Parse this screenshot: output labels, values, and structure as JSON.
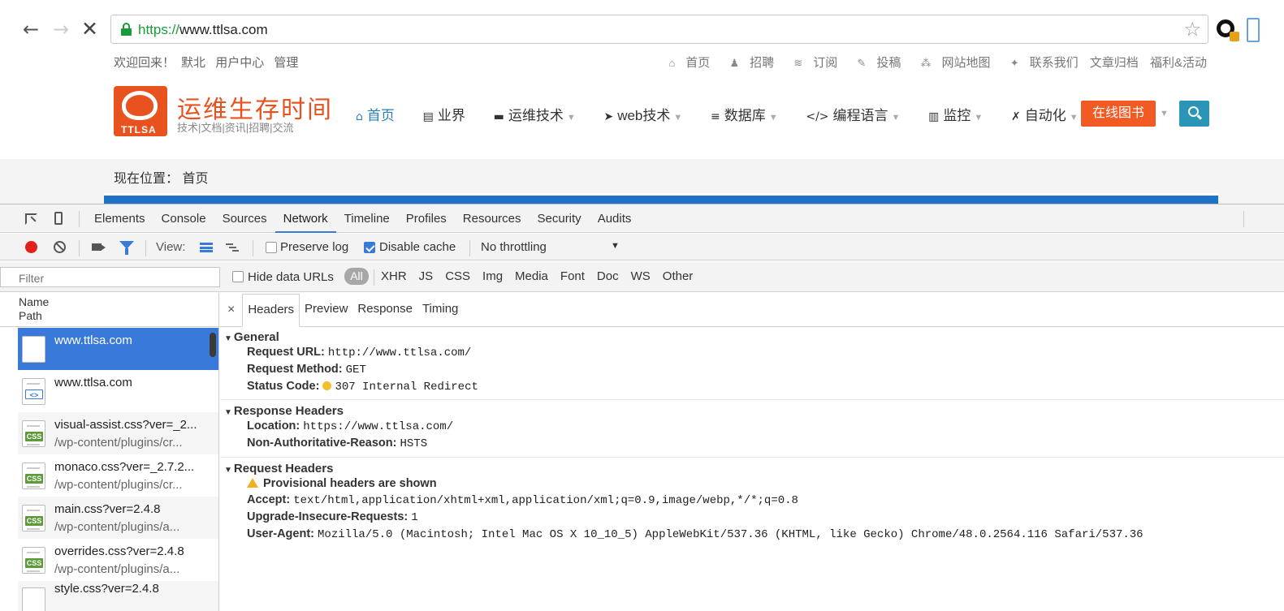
{
  "browser": {
    "url_scheme": "https://",
    "url_rest": "www.ttlsa.com",
    "star_icon": "bookmark-star-icon"
  },
  "site": {
    "welcome": "欢迎回来！",
    "user": "默北",
    "user_center": "用户中心",
    "manage": "管理",
    "top_links": [
      "首页",
      "招聘",
      "订阅",
      "投稿",
      "网站地图",
      "联系我们",
      "文章归档",
      "福利&活动"
    ],
    "logo_tag": "TTLSA",
    "logo_title": "运维生存时间",
    "logo_subtitle": "技术|文档|资讯|招聘|交流",
    "nav": [
      "首页",
      "业界",
      "运维技术",
      "web技术",
      "数据库",
      "编程语言",
      "监控",
      "自动化"
    ],
    "online_book": "在线图书",
    "breadcrumb_label": "现在位置：",
    "breadcrumb_home": "首页"
  },
  "devtools": {
    "tabs": [
      "Elements",
      "Console",
      "Sources",
      "Network",
      "Timeline",
      "Profiles",
      "Resources",
      "Security",
      "Audits"
    ],
    "active_tab": "Network",
    "view_label": "View:",
    "preserve_log": "Preserve log",
    "preserve_log_checked": false,
    "disable_cache": "Disable cache",
    "disable_cache_checked": true,
    "throttling": "No throttling",
    "filter_placeholder": "Filter",
    "hide_data_urls": "Hide data URLs",
    "type_all": "All",
    "type_filters": [
      "XHR",
      "JS",
      "CSS",
      "Img",
      "Media",
      "Font",
      "Doc",
      "WS",
      "Other"
    ],
    "list_header_name": "Name",
    "list_header_path": "Path",
    "requests": [
      {
        "name": "www.ttlsa.com",
        "path": "",
        "type": "blank"
      },
      {
        "name": "www.ttlsa.com",
        "path": "",
        "type": "html"
      },
      {
        "name": "visual-assist.css?ver=_2...",
        "path": "/wp-content/plugins/cr...",
        "type": "css"
      },
      {
        "name": "monaco.css?ver=_2.7.2...",
        "path": "/wp-content/plugins/cr...",
        "type": "css"
      },
      {
        "name": "main.css?ver=2.4.8",
        "path": "/wp-content/plugins/a...",
        "type": "css"
      },
      {
        "name": "overrides.css?ver=2.4.8",
        "path": "/wp-content/plugins/a...",
        "type": "css"
      },
      {
        "name": "style.css?ver=2.4.8",
        "path": "",
        "type": "css"
      }
    ],
    "detail_tabs": [
      "Headers",
      "Preview",
      "Response",
      "Timing"
    ],
    "general_title": "General",
    "general": {
      "request_url_key": "Request URL:",
      "request_url": "http://www.ttlsa.com/",
      "method_key": "Request Method:",
      "method": "GET",
      "status_key": "Status Code:",
      "status": "307 Internal Redirect",
      "status_color": "#f3c02b"
    },
    "response_title": "Response Headers",
    "response": {
      "location_key": "Location:",
      "location": "https://www.ttlsa.com/",
      "nar_key": "Non-Authoritative-Reason:",
      "nar": "HSTS"
    },
    "request_title": "Request Headers",
    "request": {
      "warning": "Provisional headers are shown",
      "accept_key": "Accept:",
      "accept": "text/html,application/xhtml+xml,application/xml;q=0.9,image/webp,*/*;q=0.8",
      "uir_key": "Upgrade-Insecure-Requests:",
      "uir": "1",
      "ua_key": "User-Agent:",
      "ua": "Mozilla/5.0 (Macintosh; Intel Mac OS X 10_10_5) AppleWebKit/537.36 (KHTML, like Gecko) Chrome/48.0.2564.116 Safari/537.36"
    }
  }
}
